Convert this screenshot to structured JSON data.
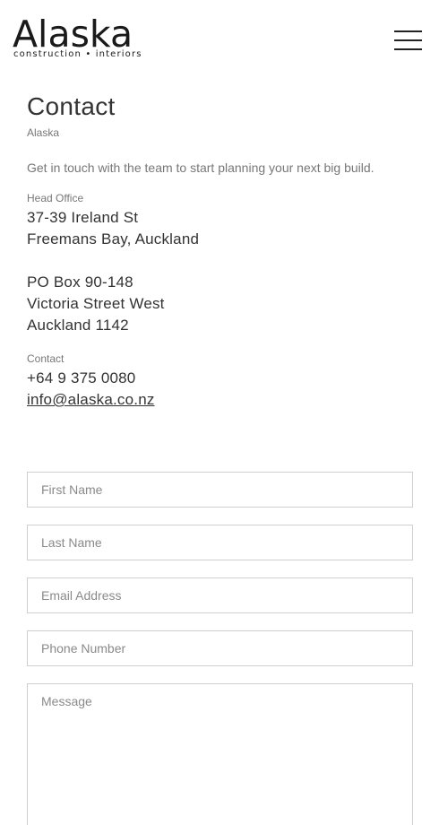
{
  "header": {
    "logo_word": "Alaska",
    "logo_tagline": "construction • interiors",
    "menu_icon": "hamburger-menu-icon"
  },
  "page": {
    "title": "Contact",
    "breadcrumb": "Alaska",
    "intro": "Get in touch with the team to start planning your next big build."
  },
  "head_office": {
    "label": "Head Office",
    "address_lines": [
      "37-39 Ireland St",
      "Freemans Bay, Auckland"
    ],
    "po_lines": [
      "PO Box 90-148",
      "Victoria Street West",
      "Auckland 1142"
    ]
  },
  "contact": {
    "label": "Contact",
    "phone": "+64 9 375 0080",
    "email": "info@alaska.co.nz"
  },
  "form": {
    "first_name_placeholder": "First Name",
    "last_name_placeholder": "Last Name",
    "email_placeholder": "Email Address",
    "phone_placeholder": "Phone Number",
    "message_placeholder": "Message"
  }
}
